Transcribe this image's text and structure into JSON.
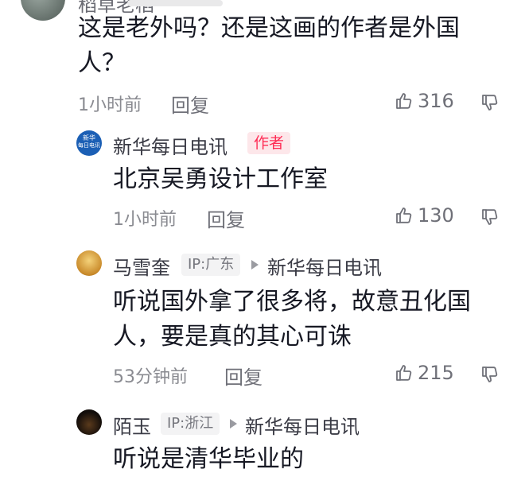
{
  "comments": [
    {
      "username": "稻草老稻",
      "text": "这是老外吗？还是这画的作者是外国人？",
      "time": "1小时前",
      "reply": "回复",
      "likes": "316"
    },
    {
      "username": "新华每日电讯",
      "author_tag": "作者",
      "text": "北京吴勇设计工作室",
      "time": "1小时前",
      "reply": "回复",
      "likes": "130"
    },
    {
      "username": "马雪奎",
      "ip": "IP:广东",
      "reply_to": "新华每日电讯",
      "text": "听说国外拿了很多将，故意丑化国人，要是真的其心可诛",
      "time": "53分钟前",
      "reply": "回复",
      "likes": "215"
    },
    {
      "username": "陌玉",
      "ip": "IP:浙江",
      "reply_to": "新华每日电讯",
      "text": "听说是清华毕业的"
    }
  ],
  "avatar_labels": {
    "xinhua_line1": "新华",
    "xinhua_line2": "每日电讯"
  },
  "icons": {
    "like": "thumbs-up-icon",
    "dislike": "thumbs-down-icon",
    "arrow": "play-arrow-icon"
  },
  "colors": {
    "author_tag_bg": "#fde7ea",
    "author_tag_text": "#fe2c55",
    "meta_text": "#8a8b91"
  }
}
